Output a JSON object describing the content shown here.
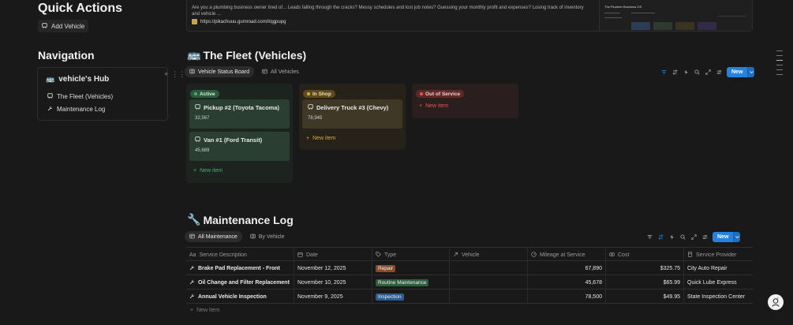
{
  "quick_actions": {
    "title": "Quick Actions",
    "add_vehicle": "Add Vehicle"
  },
  "navigation": {
    "title": "Navigation",
    "hub_title": "vehicle's Hub",
    "hub_emoji": "🚌",
    "links": [
      "The Fleet (Vehicles)",
      "Maintenance Log"
    ]
  },
  "banner": {
    "text": "Are you a plumbing business owner tired of... Leads falling through the cracks? Messy schedules and lost job notes? Guessing your monthly profit and expenses? Losing track of inventory and vehicle ...",
    "link": "https://pikachuuu.gumroad.com/l/qgpupg",
    "thumb_title": "The Plumber Business OS"
  },
  "fleet": {
    "title": "The Fleet (Vehicles)",
    "emoji": "🚌",
    "tabs": [
      "Vehicle Status Board",
      "All Vehicles"
    ],
    "new_label": "New",
    "columns": [
      {
        "status": "Active",
        "color": "#4dab6f",
        "cards": [
          {
            "name": "Pickup #2 (Toyota Tacoma)",
            "mileage": "32,567"
          },
          {
            "name": "Van #1 (Ford Transit)",
            "mileage": "45,689"
          }
        ],
        "new_item": "New item"
      },
      {
        "status": "In Shop",
        "color": "#d9a93a",
        "cards": [
          {
            "name": "Delivery Truck #3 (Chevy)",
            "mileage": "78,945"
          }
        ],
        "new_item": "New item"
      },
      {
        "status": "Out of Service",
        "color": "#e0574f",
        "cards": [],
        "new_item": "New item"
      }
    ]
  },
  "maintenance": {
    "title": "Maintenance Log",
    "emoji": "🔧",
    "tabs": [
      "All Maintenance",
      "By Vehicle"
    ],
    "new_label": "New",
    "columns": [
      "Service Description",
      "Date",
      "Type",
      "Vehicle",
      "Mileage at Service",
      "Cost",
      "Service Provider"
    ],
    "rows": [
      {
        "desc": "Brake Pad Replacement - Front",
        "date": "November 12, 2025",
        "type": "Repair",
        "type_color": "#8a4a2c",
        "vehicle": "",
        "mileage": "67,890",
        "cost": "$325.75",
        "provider": "City Auto Repair"
      },
      {
        "desc": "Oil Change and Filter Replacement",
        "date": "November 10, 2025",
        "type": "Routine Maintenance",
        "type_color": "#2f5c3f",
        "vehicle": "",
        "mileage": "45,678",
        "cost": "$65.99",
        "provider": "Quick Lube Express"
      },
      {
        "desc": "Annual Vehicle Inspection",
        "date": "November 9, 2025",
        "type": "Inspection",
        "type_color": "#2e5b8f",
        "vehicle": "",
        "mileage": "78,500",
        "cost": "$49.95",
        "provider": "State Inspection Center"
      }
    ],
    "new_item": "New item"
  }
}
